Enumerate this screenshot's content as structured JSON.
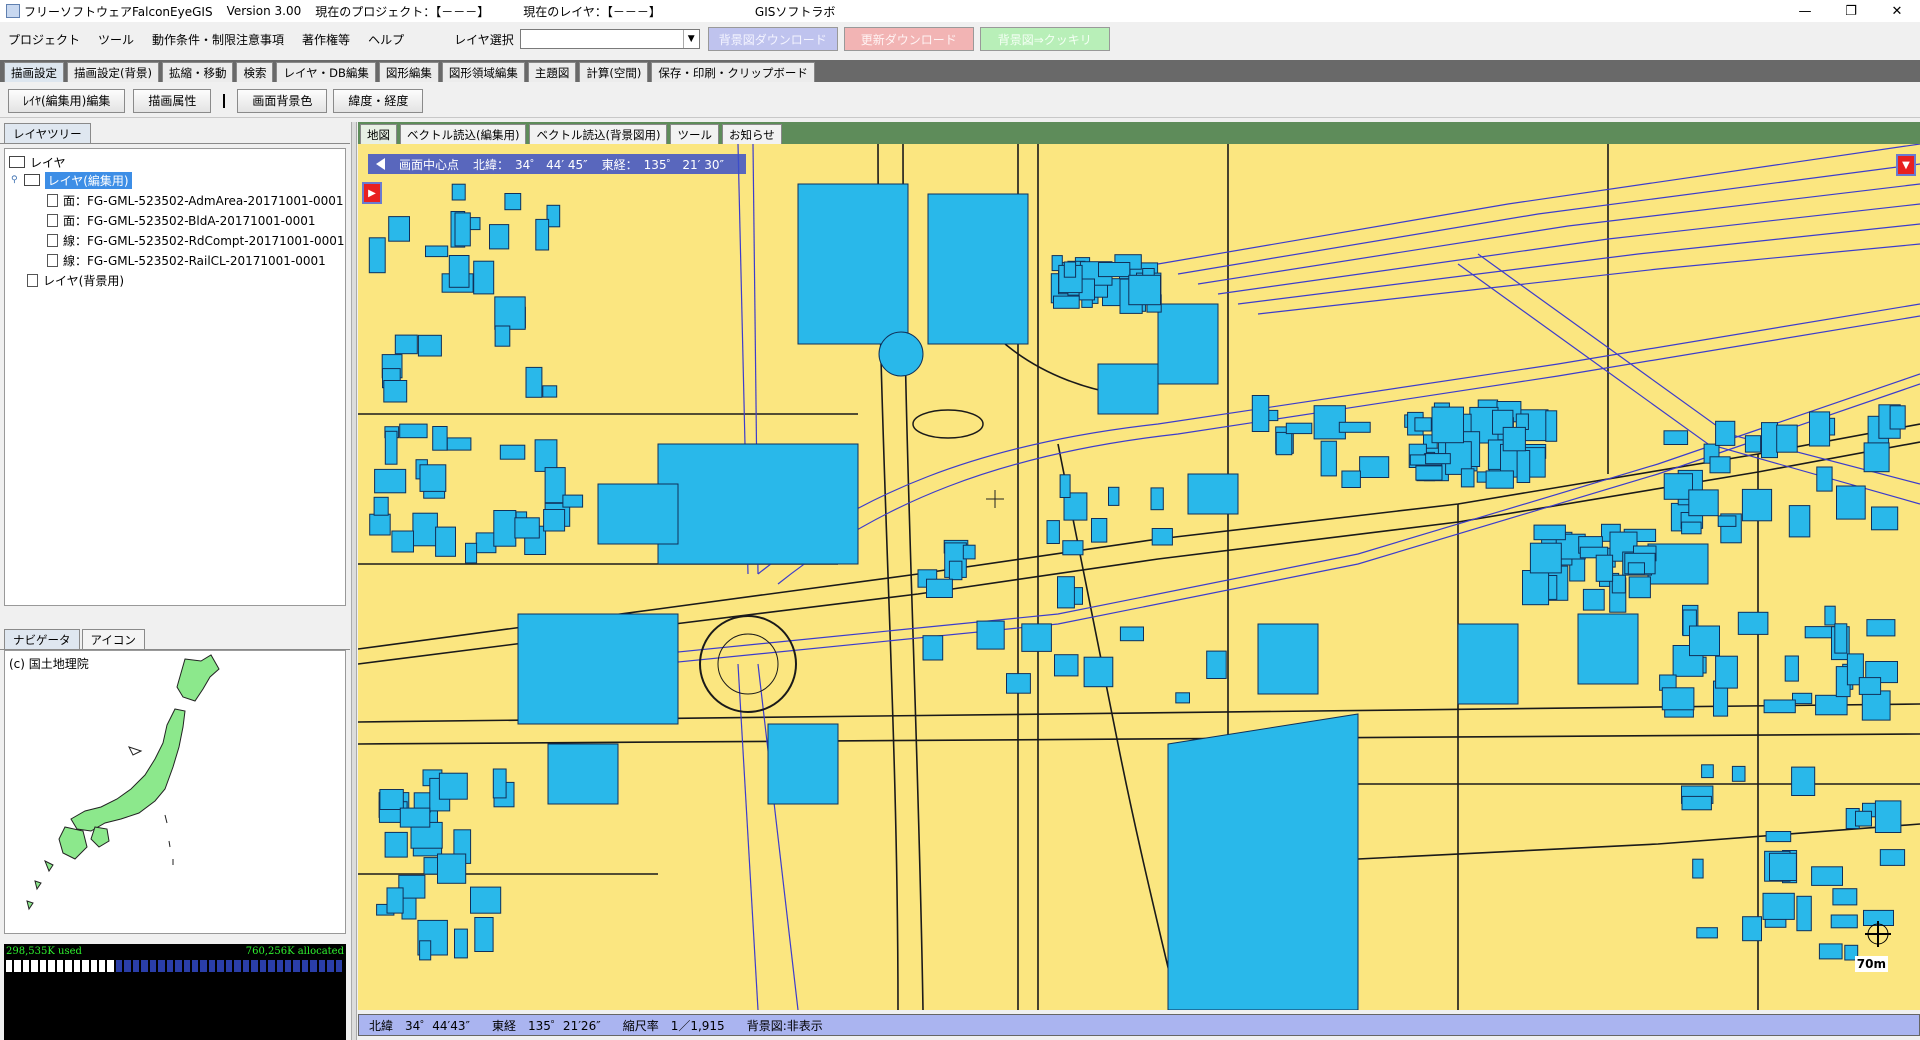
{
  "window": {
    "app_title": "フリーソフトウェアFalconEyeGIS",
    "version": "Version 3.00",
    "project": "現在のプロジェクト：【－－－】",
    "layer": "現在のレイヤ：【－－－】",
    "brand": "GISソフトラボ",
    "controls": [
      "—",
      "❐",
      "✕"
    ]
  },
  "menubar": {
    "items": [
      "プロジェクト",
      "ツール",
      "動作条件・制限注意事項",
      "著作権等",
      "ヘルプ"
    ],
    "layer_select_label": "レイヤ選択",
    "layer_select_value": "",
    "buttons": [
      {
        "label": "背景図ダウンロード",
        "color": "#bfc3ee"
      },
      {
        "label": "更新ダウンロード",
        "color": "#f2b4b4"
      },
      {
        "label": "背景図⇒クッキリ",
        "color": "#b8efb8"
      }
    ]
  },
  "main_tabs": [
    "描画設定",
    "描画設定(背景)",
    "拡縮・移動",
    "検索",
    "レイヤ・DB編集",
    "図形編集",
    "図形領域編集",
    "主題図",
    "計算(空間)",
    "保存・印刷・クリップボード"
  ],
  "toolbar": {
    "buttons": [
      "ﾚｲﾔ(編集用)編集",
      "描画属性",
      "画面背景色",
      "緯度・経度"
    ]
  },
  "left_panel": {
    "tab": "レイヤツリー",
    "tree": {
      "root": "レイヤ",
      "edit_layer": "レイヤ(編集用)",
      "children": [
        "面：FG-GML-523502-AdmArea-20171001-0001",
        "面：FG-GML-523502-BldA-20171001-0001",
        "線：FG-GML-523502-RdCompt-20171001-0001",
        "線：FG-GML-523502-RailCL-20171001-0001"
      ],
      "bg_layer": "レイヤ(背景用)"
    },
    "nav_tabs": [
      "ナビゲータ",
      "アイコン"
    ],
    "nav_copyright": "(c) 国土地理院",
    "memory": {
      "used": "298,535K used",
      "allocated": "760,256K allocated",
      "used_fraction": 0.33
    }
  },
  "map_tabs": [
    "地図",
    "ベクトル読込(編集用)",
    "ベクトル読込(背景図用)",
    "ツール",
    "お知らせ"
  ],
  "map": {
    "center_label": "画面中心点",
    "center_lat": "北緯：　34゜ 44′ 45″",
    "center_lon": "東経：　135゜ 21′ 30″",
    "scale_label": "70m",
    "colors": {
      "land": "#fbe680",
      "building": "#29b8ea",
      "road": "#1a1a1a",
      "rail": "#3c3ccc"
    }
  },
  "statusbar": {
    "lat": "北緯　34゜44′43″",
    "lon": "東経　135゜21′26″",
    "scale": "縮尺率　1／1,915",
    "background": "背景図:非表示"
  }
}
